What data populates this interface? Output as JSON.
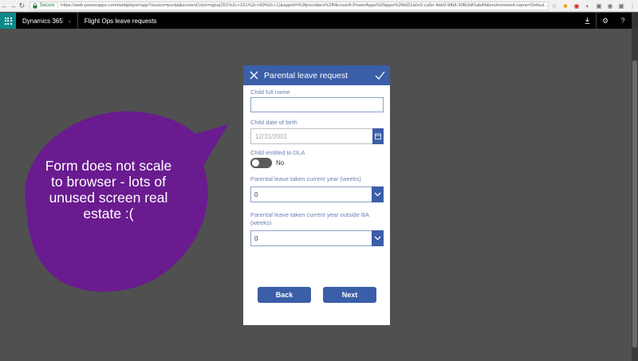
{
  "browser": {
    "back_icon": "arrow-left-icon",
    "forward_icon": "arrow-right-icon",
    "reload_icon": "reload-icon",
    "secure_label": "Secure",
    "url": "https://web.powerapps.com/webplayer/app?source=portal&screenColor=rgba(251%2c+101%2c+60%2c+1)&appId=%2fproviders%2fMicrosoft.PowerApps%2fapps%2fdd31a0c6-ca5e-4de0-9fb8-30fb3df1ab44&environment-name=Defaul..."
  },
  "header": {
    "brand": "Dynamics 365",
    "app_title": "Flight Ops leave requests",
    "icons": [
      "download-icon",
      "settings-icon",
      "help-icon"
    ],
    "help_label": "?"
  },
  "form": {
    "title": "Parental leave request",
    "fields": {
      "child_name_label": "Child full name",
      "child_name_value": "",
      "dob_label": "Child date of birth",
      "dob_placeholder": "12/31/2001",
      "dla_label": "Child entitled to DLA",
      "dla_value": "No",
      "current_year_label": "Parental leave taken current year (weeks)",
      "current_year_value": "0",
      "outside_ba_label": "Parental leave taken current year outside BA (weeks)",
      "outside_ba_value": "0"
    },
    "back_label": "Back",
    "next_label": "Next"
  },
  "callout": {
    "text": "Form does not scale to browser - lots of unused screen real estate :(",
    "color": "#6a1b8f"
  },
  "colors": {
    "accent": "#3b5ea8",
    "app_bar": "#000000",
    "waffle": "#0e8a8a",
    "canvas": "#505050"
  }
}
